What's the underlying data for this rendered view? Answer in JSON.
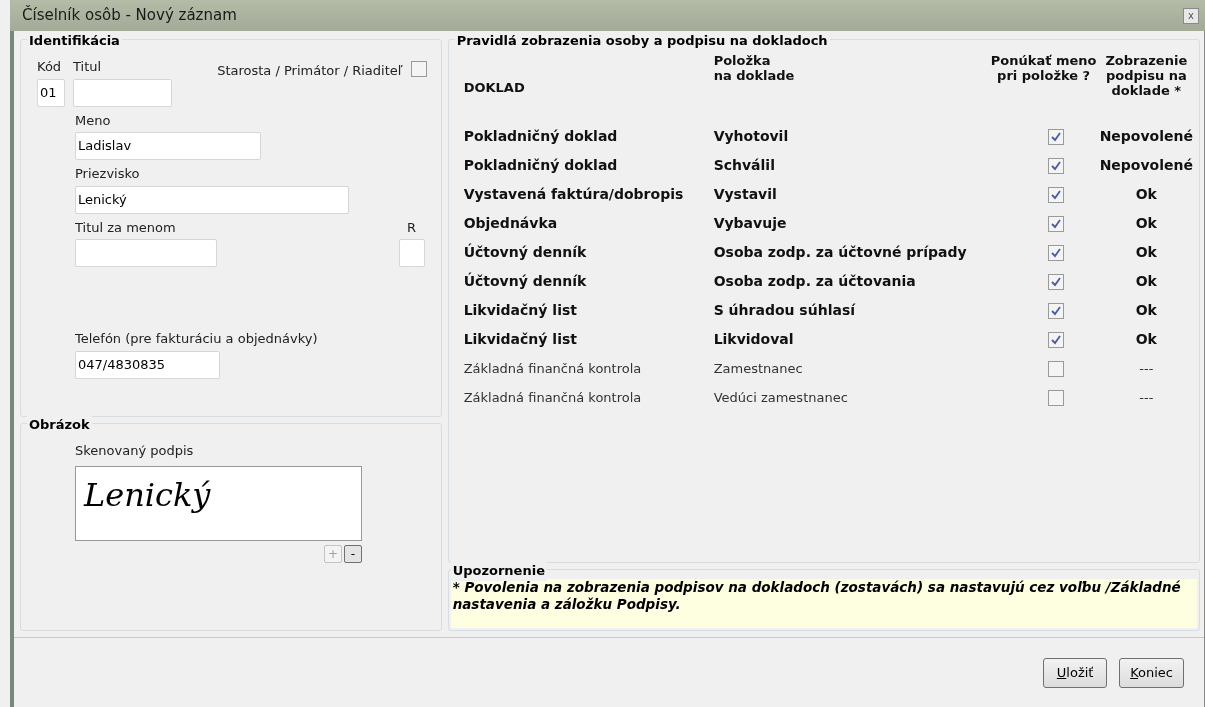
{
  "window": {
    "title": "Číselník osôb - Nový záznam",
    "close": "x"
  },
  "identification": {
    "title": "Identifikácia",
    "code": {
      "label": "Kód",
      "value": "01"
    },
    "title_field": {
      "label": "Titul"
    },
    "mayor": {
      "label": "Starosta / Primátor / Riaditeľ",
      "checked": false
    },
    "first_name": {
      "label": "Meno",
      "value": "Ladislav"
    },
    "last_name": {
      "label": "Priezvisko",
      "value": "Lenický"
    },
    "title_after": {
      "label": "Titul za menom"
    },
    "r": {
      "label": "R"
    },
    "phone": {
      "label": "Telefón (pre fakturáciu a objednávky)",
      "value": "047/4830835"
    }
  },
  "image": {
    "title": "Obrázok",
    "label": "Skenovaný podpis",
    "signature": "Lenický",
    "add": {
      "label": "+",
      "disabled": true
    },
    "remove": {
      "label": "-",
      "disabled": false
    }
  },
  "rules": {
    "title": "Pravidlá zobrazenia osoby a podpisu na dokladoch",
    "columns": [
      "DOKLAD",
      "Položka\nna doklade",
      "Ponúkať meno\npri položke ?",
      "Zobrazenie\npodpisu na\ndoklade *"
    ],
    "rows": [
      {
        "document": "Pokladničný doklad",
        "item": "Vyhotovil",
        "checked": true,
        "signature": "Nepovolené",
        "emphasized": true
      },
      {
        "document": "Pokladničný doklad",
        "item": "Schválil",
        "checked": true,
        "signature": "Nepovolené",
        "emphasized": true
      },
      {
        "document": "Vystavená faktúra/dobropis",
        "item": "Vystavil",
        "checked": true,
        "signature": "Ok",
        "emphasized": true
      },
      {
        "document": "Objednávka",
        "item": "Vybavuje",
        "checked": true,
        "signature": "Ok",
        "emphasized": true
      },
      {
        "document": "Účtovný denník",
        "item": "Osoba zodp. za účtovné prípady",
        "checked": true,
        "signature": "Ok",
        "emphasized": true
      },
      {
        "document": "Účtovný denník",
        "item": "Osoba zodp. za účtovania",
        "checked": true,
        "signature": "Ok",
        "emphasized": true
      },
      {
        "document": "Likvidačný list",
        "item": "S úhradou súhlasí",
        "checked": true,
        "signature": "Ok",
        "emphasized": true
      },
      {
        "document": "Likvidačný list",
        "item": "Likvidoval",
        "checked": true,
        "signature": "Ok",
        "emphasized": true
      },
      {
        "document": "Základná finančná kontrola",
        "item": "Zamestnanec",
        "checked": false,
        "signature": "---",
        "emphasized": false
      },
      {
        "document": "Základná finančná kontrola",
        "item": "Vedúci zamestnanec",
        "checked": false,
        "signature": "---",
        "emphasized": false
      }
    ]
  },
  "notice": {
    "title": "Upozornenie",
    "text": "* Povolenia na zobrazenia podpisov na dokladoch (zostavách) sa nastavujú cez voľbu /Základné nastavenia a záložku Podpisy."
  },
  "buttons": [
    "Uložiť",
    "Koniec"
  ]
}
